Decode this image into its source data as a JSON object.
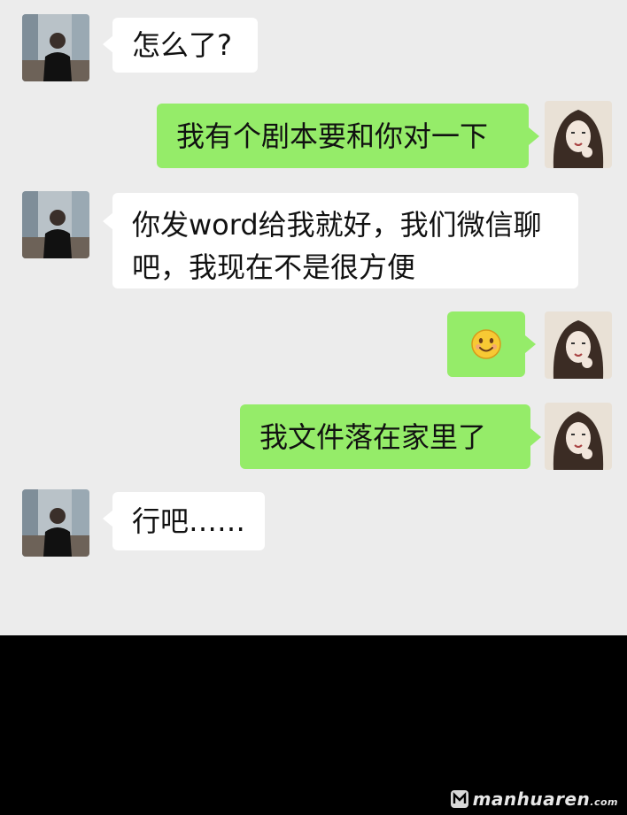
{
  "chat": {
    "messages": [
      {
        "side": "left",
        "text": "怎么了?"
      },
      {
        "side": "right",
        "text": "我有个剧本要和你对一下"
      },
      {
        "side": "left",
        "lines": [
          "你发word给我就好，我们微信聊",
          "吧，我现在不是很方便"
        ]
      },
      {
        "side": "right",
        "emoji": "smile-emoji"
      },
      {
        "side": "right",
        "text": "我文件落在家里了"
      },
      {
        "side": "left",
        "text": "行吧……"
      }
    ]
  },
  "watermark": {
    "text": "manhuaren",
    "suffix": ".com"
  },
  "colors": {
    "chat_bg": "#ececec",
    "bubble_left": "#ffffff",
    "bubble_right": "#95ec69",
    "bottom": "#000000"
  }
}
